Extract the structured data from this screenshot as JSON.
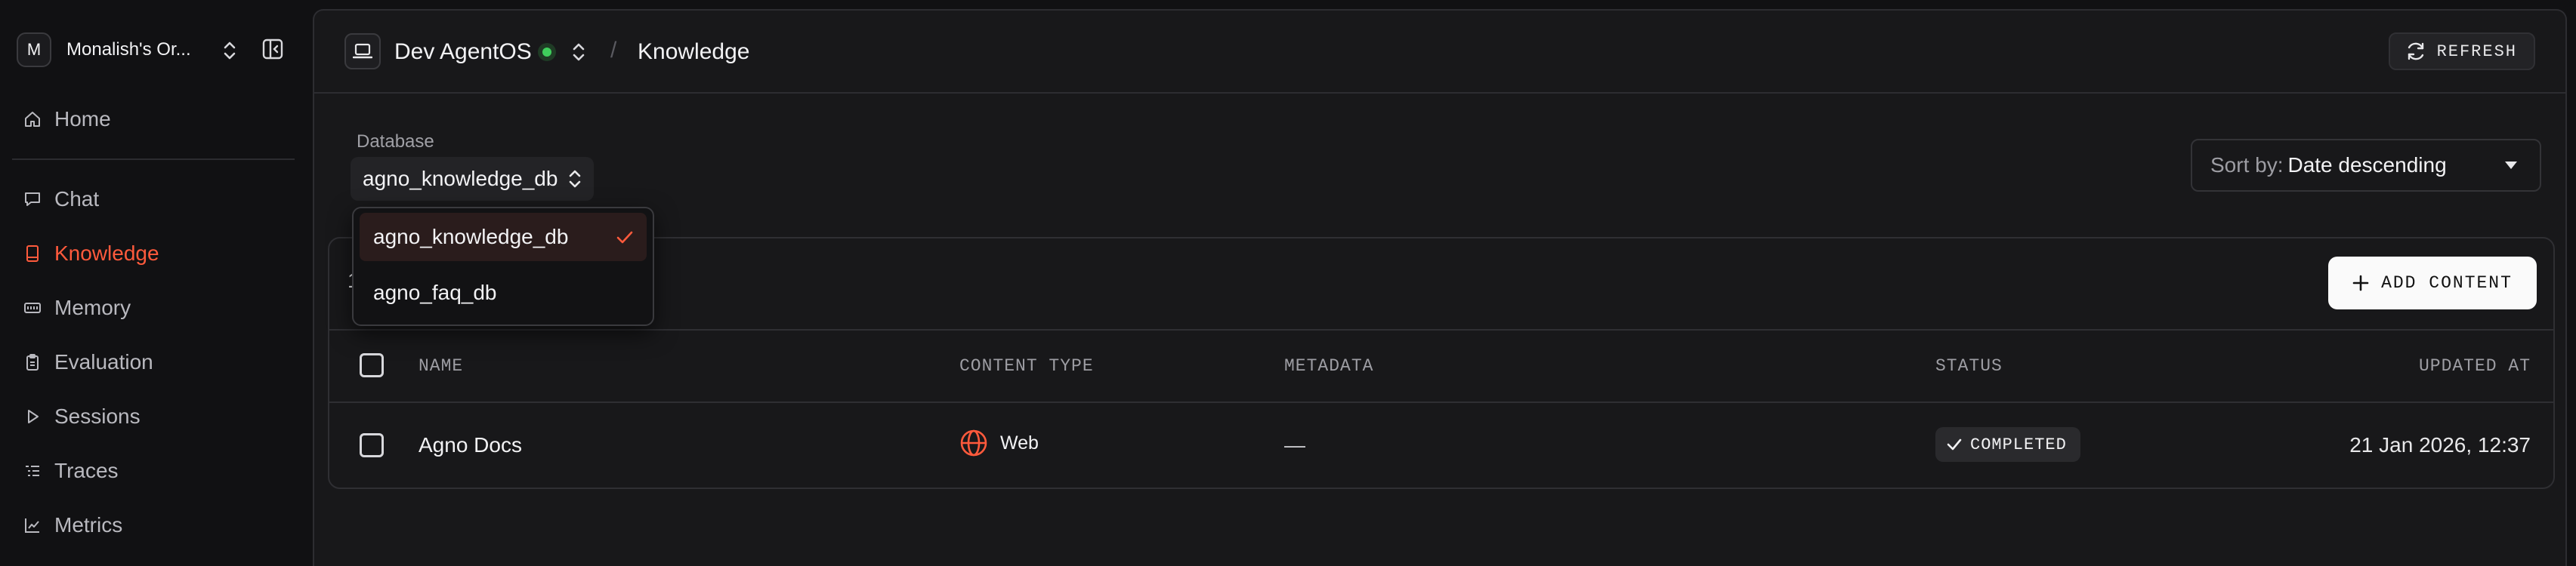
{
  "sidebar": {
    "org": {
      "avatar_letter": "M",
      "name": "Monalish's Or..."
    },
    "items": [
      {
        "label": "Home",
        "icon": "home-icon"
      },
      {
        "label": "Chat",
        "icon": "chat-icon"
      },
      {
        "label": "Knowledge",
        "icon": "knowledge-icon",
        "active": true
      },
      {
        "label": "Memory",
        "icon": "memory-icon"
      },
      {
        "label": "Evaluation",
        "icon": "clipboard-icon"
      },
      {
        "label": "Sessions",
        "icon": "play-icon"
      },
      {
        "label": "Traces",
        "icon": "traces-icon"
      },
      {
        "label": "Metrics",
        "icon": "chart-icon"
      }
    ],
    "active_color": "#ff5a3c"
  },
  "header": {
    "os_name": "Dev AgentOS",
    "status_color": "#3fcf5c",
    "separator": "/",
    "breadcrumb_current": "Knowledge",
    "refresh_label": "REFRESH"
  },
  "database": {
    "label": "Database",
    "selected": "agno_knowledge_db",
    "options": [
      "agno_knowledge_db",
      "agno_faq_db"
    ]
  },
  "sort": {
    "label": "Sort by:",
    "value": "Date descending"
  },
  "card": {
    "title": "1",
    "add_label": "ADD CONTENT"
  },
  "table": {
    "columns": [
      "NAME",
      "CONTENT TYPE",
      "METADATA",
      "STATUS",
      "UPDATED AT"
    ],
    "rows": [
      {
        "name": "Agno Docs",
        "content_type": "Web",
        "metadata": "—",
        "status": "COMPLETED",
        "updated_at": "21 Jan 2026, 12:37"
      }
    ]
  }
}
